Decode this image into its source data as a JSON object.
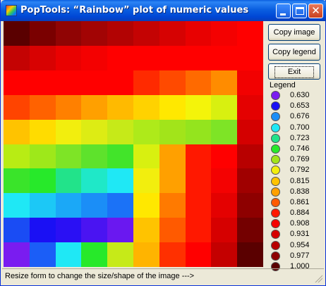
{
  "window": {
    "title": "PopTools: “Rainbow” plot of numeric values"
  },
  "buttons": {
    "copy_image": "Copy image",
    "copy_legend": "Copy legend",
    "exit": "Exit"
  },
  "legend": {
    "title": "Legend",
    "items": [
      {
        "label": "0.630",
        "color": "#7a1cf0"
      },
      {
        "label": "0.653",
        "color": "#1a10f4"
      },
      {
        "label": "0.676",
        "color": "#1b8ef7"
      },
      {
        "label": "0.700",
        "color": "#1fe8f5"
      },
      {
        "label": "0.723",
        "color": "#22e38a"
      },
      {
        "label": "0.746",
        "color": "#27e92a"
      },
      {
        "label": "0.769",
        "color": "#a2e41a"
      },
      {
        "label": "0.792",
        "color": "#f2ee0e"
      },
      {
        "label": "0.815",
        "color": "#ffc300"
      },
      {
        "label": "0.838",
        "color": "#ffa000"
      },
      {
        "label": "0.861",
        "color": "#ff5a00"
      },
      {
        "label": "0.884",
        "color": "#ff1800"
      },
      {
        "label": "0.908",
        "color": "#f40202"
      },
      {
        "label": "0.931",
        "color": "#d60000"
      },
      {
        "label": "0.954",
        "color": "#b80000"
      },
      {
        "label": "0.977",
        "color": "#8e0000"
      },
      {
        "label": "1.000",
        "color": "#5a0000"
      }
    ]
  },
  "heatmap": {
    "rows": 10,
    "cols": 10,
    "cells": [
      [
        "#5a0000",
        "#7a0000",
        "#900404",
        "#a20404",
        "#b20303",
        "#c40303",
        "#d60202",
        "#e80101",
        "#f40101",
        "#ff0000"
      ],
      [
        "#c40303",
        "#d80202",
        "#ea0101",
        "#f40101",
        "#ff0000",
        "#ff0000",
        "#ff0000",
        "#ff0000",
        "#ff0000",
        "#ff0000"
      ],
      [
        "#ff0000",
        "#ff0000",
        "#ff0000",
        "#ff0000",
        "#ff0000",
        "#ff2a00",
        "#ff4a00",
        "#ff6a00",
        "#ff8c00",
        "#f20101"
      ],
      [
        "#ff4400",
        "#ff6200",
        "#ff8000",
        "#ffa000",
        "#ffba00",
        "#ffd200",
        "#ffe800",
        "#f4f40a",
        "#d8f010",
        "#e40101"
      ],
      [
        "#ffc300",
        "#ffdc00",
        "#f2ee0e",
        "#ddec14",
        "#c6ea18",
        "#aeea1a",
        "#a2e41a",
        "#94e41e",
        "#7ee426",
        "#d40000"
      ],
      [
        "#b8ec14",
        "#9ee81a",
        "#7ee426",
        "#5ee22c",
        "#42e42a",
        "#d8f010",
        "#ffa000",
        "#ff1800",
        "#ff0000",
        "#b80000"
      ],
      [
        "#3ae42a",
        "#27e92a",
        "#22e38a",
        "#1fe8c8",
        "#1fe8f5",
        "#f2ee0e",
        "#ffa000",
        "#ff1800",
        "#f40202",
        "#a00000"
      ],
      [
        "#1fe8f5",
        "#1cc8f6",
        "#1ba8f7",
        "#1b8ef7",
        "#1b72f7",
        "#ffe800",
        "#ff7a00",
        "#ff1800",
        "#e40101",
        "#8e0000"
      ],
      [
        "#1a4cf4",
        "#1a10f4",
        "#2a10f4",
        "#4a14f2",
        "#6a18f0",
        "#ffc300",
        "#ff5a00",
        "#ff1800",
        "#d60000",
        "#740000"
      ],
      [
        "#7a1cf0",
        "#1b5ef7",
        "#1fe8f5",
        "#27e92a",
        "#c6ea18",
        "#ffb400",
        "#ff3000",
        "#ff0000",
        "#c40000",
        "#5a0000"
      ]
    ]
  },
  "status": {
    "text": "Resize form to change the size/shape of the image --->"
  }
}
